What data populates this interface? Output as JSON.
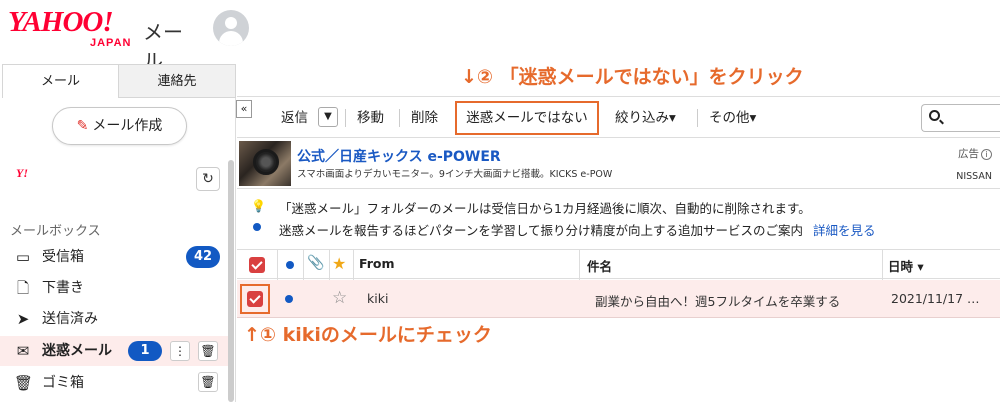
{
  "header": {
    "logo_main": "YAHOO!",
    "logo_sub": "JAPAN",
    "logo_service": "メール"
  },
  "tabs": [
    {
      "label": "メール"
    },
    {
      "label": "連絡先"
    }
  ],
  "compose_label": "メール作成",
  "sidebar": {
    "account_logo": "Y!",
    "section_label": "メールボックス",
    "folders": [
      {
        "label": "受信箱",
        "icon": "inbox-icon",
        "badge": "42"
      },
      {
        "label": "下書き",
        "icon": "draft-icon"
      },
      {
        "label": "送信済み",
        "icon": "sent-icon"
      },
      {
        "label": "迷惑メール",
        "icon": "spam-icon",
        "badge": "1"
      },
      {
        "label": "ゴミ箱",
        "icon": "trash-icon"
      }
    ]
  },
  "annotations": {
    "top": "↓② 「迷惑メールではない」をクリック",
    "bottom": "↑① kikiのメールにチェック"
  },
  "toolbar": {
    "collapse": "«",
    "reply": "返信",
    "move": "移動",
    "delete": "削除",
    "not_spam": "迷惑メールではない",
    "filter": "絞り込み▾",
    "other": "その他▾"
  },
  "ad": {
    "title": "公式／日産キックス e-POWER",
    "description": "スマホ画面よりデカいモニター。9インチ大画面ナビ搭載。KICKS e-POW",
    "tag": "広告",
    "brand": "NISSAN"
  },
  "notice": {
    "line1": "「迷惑メール」フォルダーのメールは受信日から1カ月経過後に順次、自動的に削除されます。",
    "line2": "迷惑メールを報告するほどパターンを学習して振り分け精度が向上する追加サービスのご案内",
    "link": "詳細を見る"
  },
  "list": {
    "columns": {
      "from": "From",
      "subject": "件名",
      "date": "日時 ▾"
    },
    "rows": [
      {
        "from": "kiki",
        "subject": "副業から自由へ！週5フルタイムを卒業する",
        "date": "2021/11/17 …"
      }
    ]
  },
  "colors": {
    "brand_red": "#ff0033",
    "annotation_orange": "#e66a2c",
    "badge_blue": "#1259c3",
    "link_blue": "#1a59c3",
    "selected_row": "#fdeceb"
  }
}
